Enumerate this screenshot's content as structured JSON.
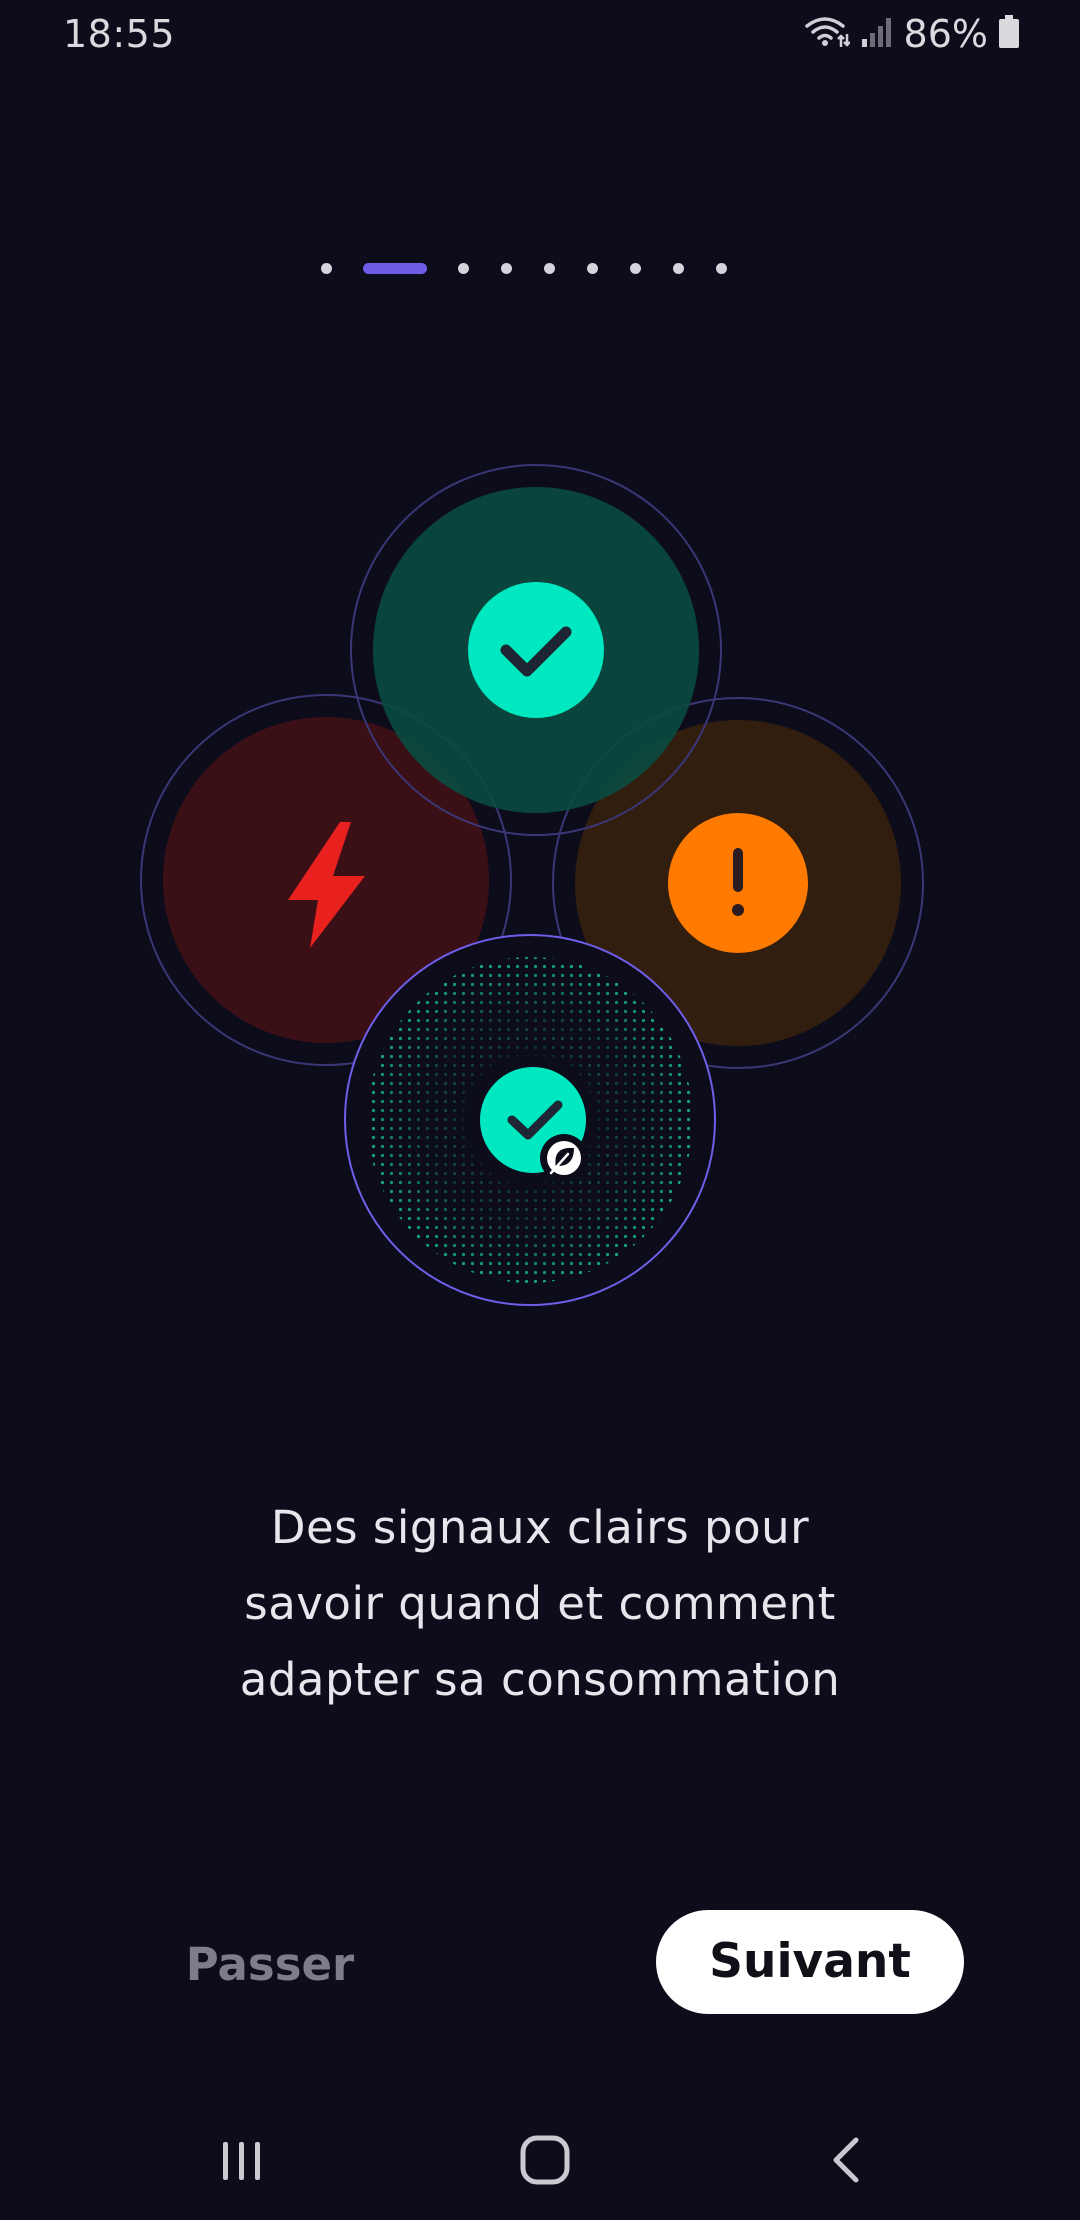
{
  "status_bar": {
    "time": "18:55",
    "battery_percent": "86%",
    "icons": [
      "wifi-icon",
      "signal-icon",
      "battery-icon"
    ]
  },
  "pager": {
    "total_pages": 9,
    "active_page": 2,
    "active_color": "#6e5de6"
  },
  "illustration": {
    "signals": [
      {
        "name": "green-check-signal",
        "icon": "check-icon",
        "color": "#00e8c2"
      },
      {
        "name": "red-lightning-signal",
        "icon": "lightning-icon",
        "color": "#e8201e"
      },
      {
        "name": "orange-warning-signal",
        "icon": "exclamation-icon",
        "color": "#ff7a00"
      },
      {
        "name": "eco-check-signal",
        "icon": "leaf-icon",
        "color": "#00e8c2"
      }
    ]
  },
  "message": {
    "line1": "Des signaux clairs pour",
    "line2": "savoir quand et comment",
    "line3": "adapter sa consommation"
  },
  "actions": {
    "skip_label": "Passer",
    "next_label": "Suivant"
  },
  "nav_bar": {
    "icons": [
      "recent-apps-icon",
      "home-icon",
      "back-icon"
    ]
  }
}
